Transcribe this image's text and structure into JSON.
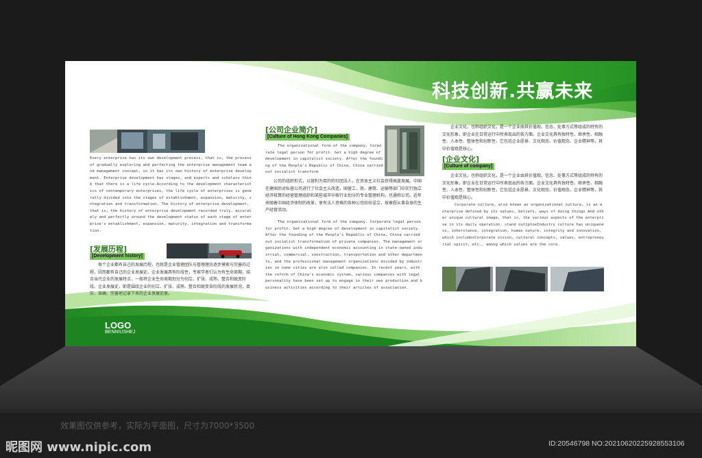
{
  "board": {
    "title": "科技创新.共赢未来",
    "logo": {
      "name": "LOGO",
      "sub": "BENNIUSHEJ"
    },
    "col1": {
      "body_en": "Every enterprise has its own development process, that is, the process of gradually exploring and perfecting the enterprise management team and management concept, so it has its own history of enterprise development. Enterprise development has stages, and experts and scholars think that there is a life cycle.According to the development characteristics of contemporary enterprises, the life cycle of enterprises is generally divided into the stages of establishment, expansion, maturity, integration and transformation. The history of enterprise development, that is, the history of enterprise development recorded truly, accurately and perfectly around the development status of each stage of enterprise's establishment, expansion, maturity, integration and transformation.",
      "heading_cn": "[发展历程]",
      "heading_en": "[Development history]",
      "body_cn": "每个企业都有自己的发展历程，也就是企业管理团队与管理理念逐步摸索与完善的过程，因而都有自己的企业发展史。企业发展具有阶段性，专家学者们认为有生命周期，结合当代企业的发展特点，一般将企业生命周期划分为创立、扩张、成熟、整合和蜕变阶段。企业发展史，即是围绕企业的创立、扩张、成熟、整合和蜕变各阶段的发展状况，真实、准确、完善地记录下来的企业发展史册。"
    },
    "col2": {
      "heading_cn": "[公司企业简介]",
      "heading_en": "[Culture of Hong Kong Companies]",
      "body_en_1": "The organizational form of the company. Corporate legal person for profit. Get a high degree of development in capitalist society. After the founding of the People's Republic of China, China carried out socialist transform",
      "body_cn": "公司的组织形式，以营利为目的的社团法人，在资本主义社会获得高度发展。中国在建国后对私营公司进行了社会主义改造，国营工、商、建筑、运输等部门中实行独立经济核算的经营管理组织和某些城市中按行业划分的专业管理机构，也通称公司。近年来随着中国经济体制的改革，享有法人资格的各种公司纷纷设立，按章程从事自身的生产经营活动。",
      "body_en_2": "The organizational form of the company. Corporate legal person for profit. Get a high degree of development in capitalist society. After the founding of the People's Republic of China, China carried out socialist transformation of private companies. The management organizations with independent economic accounting in state-owned industrial, commercial, construction, transportation and other departments, and the professional management organizations divided by industries in some cities are also called companies. In recent years, with the reform of China's economic system, various companies with legal personality have been set up to engage in their own production and business activities according to their articles of association."
    },
    "col3": {
      "body_cn_1": "企业文化，也称组织文化，是一个企业由其价值观、信念、处事方式等组成的特有的文化形象，即企业在日常运行中所表现出的各方面。企业文化具有独特性、继承性、相融性、人本性、整体性和创新性，它包括企业愿景、文化观念、价值观念、企业精神等，其中价值观是核心。",
      "heading_cn": "[企业文化]",
      "heading_en": "[Culture of company]",
      "body_cn_2": "企业文化，也称组织文化，是一个企业由其价值观、信念、处事方式等组成的特有的文化形象，即企业在日常运行中所表现出的各方面。企业文化具有独特性、继承性、相融性、人本性、整体性和创新性，它包括企业愿景、文化观念、价值观念、企业精神等，其中价值观是核心。",
      "body_en": "Corporate culture, also known as organizational culture, is an enterprise defined by its values, beliefs, ways of doing things And other unique cultural image, that is, the various aspects of the enterprise in its daily operation. stand outiptoeIndustry culture has uniqueness, inheritance, integration, human nature, integrity and innovation, which includesCorporate vision, cultural concepts, values, entrepreneurial spirit, etc., among which values are the core."
    }
  },
  "footer": {
    "caption": "效果图仅供参考，实际为平面图，尺寸为7000*3500",
    "watermark_left": "昵图网 www.nipic.com",
    "watermark_right": "ID:20546798 NO:20210620225928553106"
  },
  "colors": {
    "brand_green": "#2e9a2a",
    "light_green": "#8fd36b",
    "background": "#1b1b1b"
  }
}
